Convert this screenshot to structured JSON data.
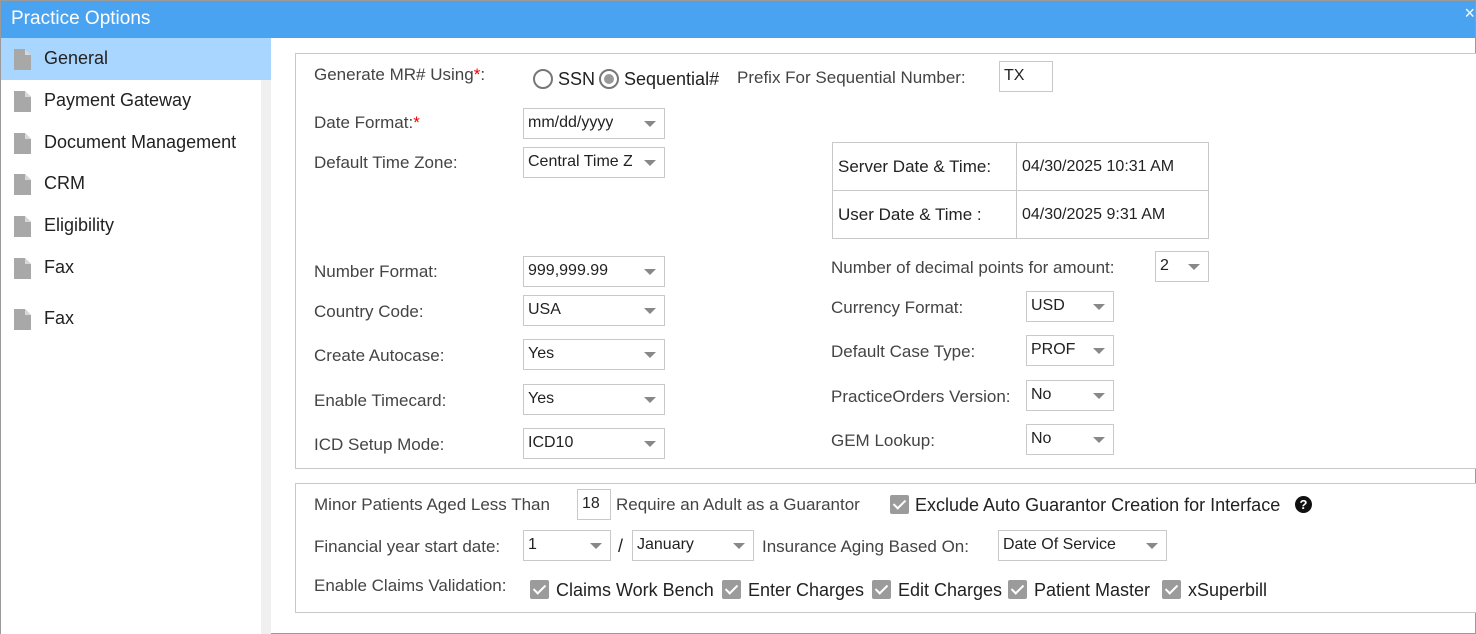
{
  "window": {
    "title": "Practice Options",
    "close_glyph": "×"
  },
  "sidebar": {
    "items": [
      {
        "label": "General"
      },
      {
        "label": "Payment Gateway"
      },
      {
        "label": "Document Management"
      },
      {
        "label": "CRM"
      },
      {
        "label": "Eligibility"
      },
      {
        "label": "Fax"
      },
      {
        "label": "Fax"
      }
    ],
    "icon": "document-icon"
  },
  "general": {
    "mr_label": "Generate MR# Using",
    "required_mark": "*",
    "opt_ssn": "SSN",
    "opt_sequential": "Sequential#",
    "prefix_label": "Prefix For Sequential Number:",
    "prefix_value": "TX",
    "date_format_label": "Date Format:",
    "date_format_value": "mm/dd/yyyy",
    "timezone_label": "Default Time Zone:",
    "timezone_value": "Central Time Zone",
    "server_dt_label": "Server Date & Time:",
    "server_dt_value": "04/30/2025 10:31 AM",
    "user_dt_label": "User Date & Time :",
    "user_dt_value": "04/30/2025 9:31 AM",
    "number_format_label": "Number Format:",
    "number_format_value": "999,999.99",
    "decimal_label": "Number of decimal points for amount:",
    "decimal_value": "2",
    "country_label": "Country Code:",
    "country_value": "USA",
    "currency_label": "Currency Format:",
    "currency_value": "USD",
    "autocase_label": "Create Autocase:",
    "autocase_value": "Yes",
    "case_type_label": "Default Case Type:",
    "case_type_value": "PROF",
    "timecard_label": "Enable Timecard:",
    "timecard_value": "Yes",
    "po_version_label": "PracticeOrders Version:",
    "po_version_value": "No",
    "icd_label": "ICD Setup Mode:",
    "icd_value": "ICD10",
    "gem_label": "GEM Lookup:",
    "gem_value": "No"
  },
  "guarantor": {
    "minor_label": "Minor Patients Aged Less Than",
    "minor_age": "18",
    "require_adult_label": "Require an Adult as a Guarantor",
    "exclude_label": "Exclude Auto Guarantor Creation for Interface",
    "help_glyph": "?",
    "fy_label": "Financial year start date:",
    "fy_day": "1",
    "fy_separator": "/",
    "fy_month": "January",
    "aging_label": "Insurance Aging Based On:",
    "aging_value": "Date Of Service",
    "claims_label": "Enable Claims Validation:",
    "claims_options": [
      "Claims Work Bench",
      "Enter Charges",
      "Edit Charges",
      "Patient Master",
      "xSuperbill"
    ]
  },
  "colors": {
    "titlebar": "#4aa3f0",
    "active_nav": "#a9d6ff",
    "required": "#ee0000"
  }
}
